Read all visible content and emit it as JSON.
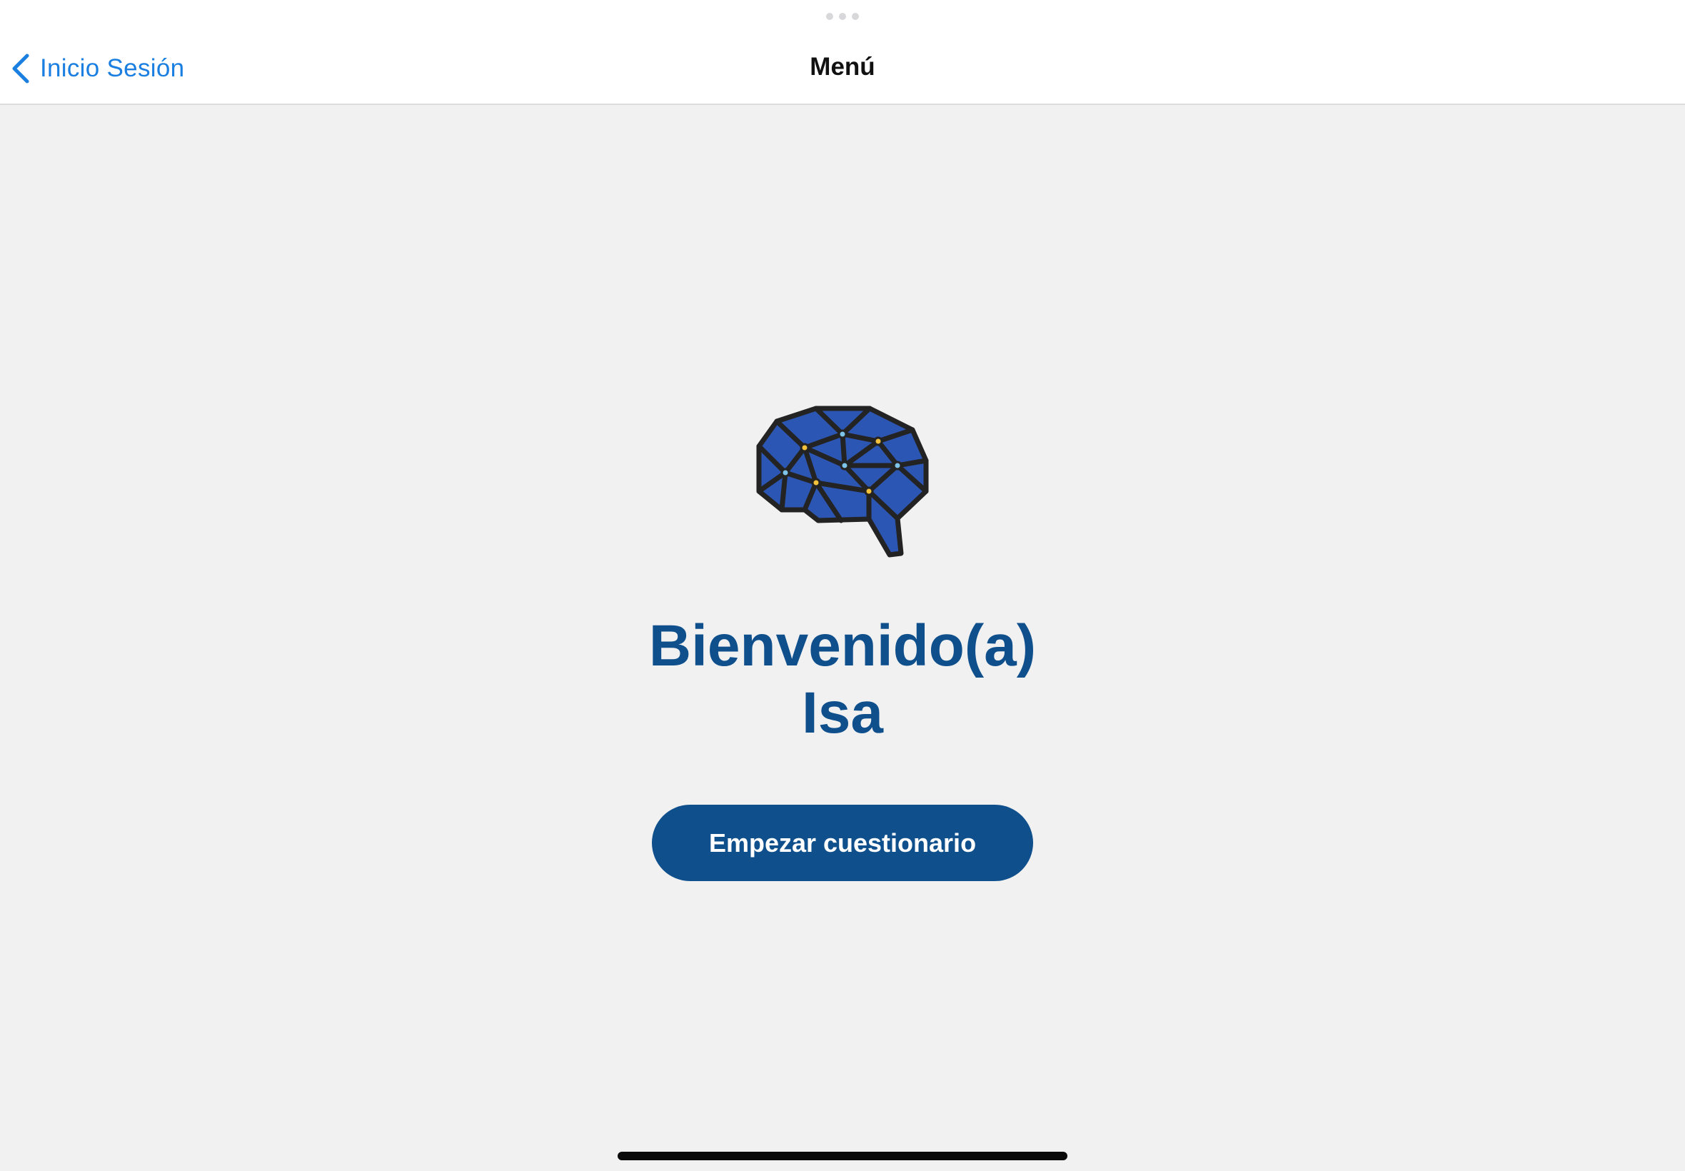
{
  "navbar": {
    "back_label": "Inicio Sesión",
    "back_icon": "chevron-left-icon",
    "title": "Menú"
  },
  "main": {
    "logo_icon": "brain-network-icon",
    "welcome_line1": "Bienvenido(a)",
    "welcome_line2": "Isa",
    "start_button_label": "Empezar cuestionario"
  },
  "colors": {
    "accent": "#1a7fe0",
    "brand": "#0e4f8c",
    "background": "#f1f1f2",
    "brain_fill": "#2c56b3",
    "node_yellow": "#f4c13a",
    "node_blue": "#7ec3e8"
  }
}
